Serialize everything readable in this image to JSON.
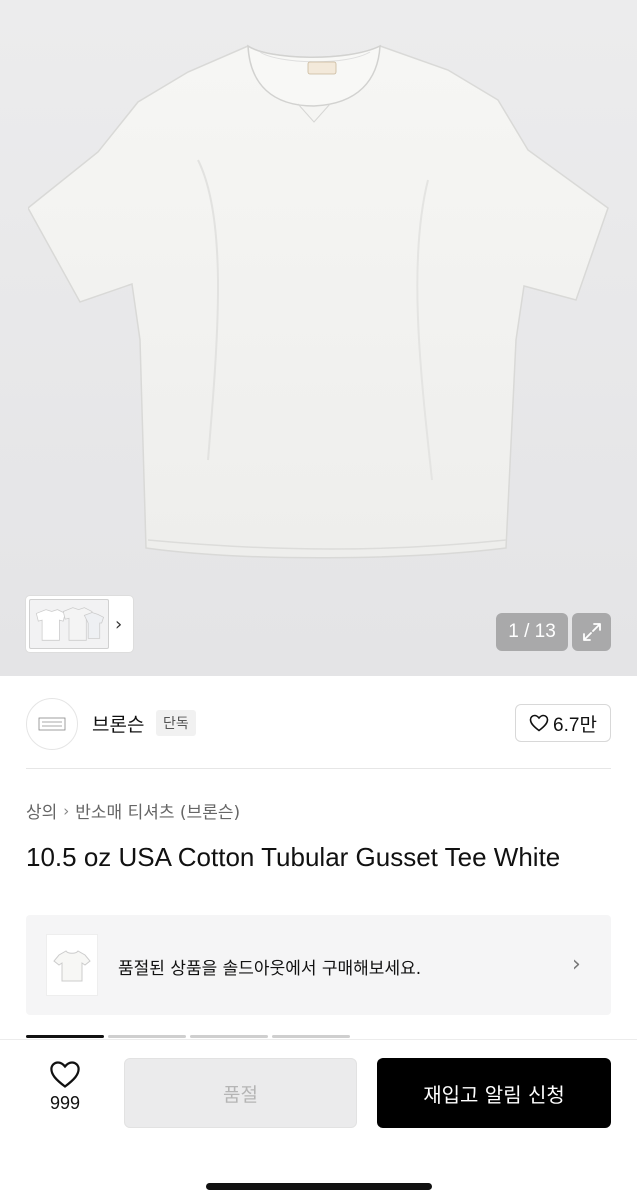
{
  "gallery": {
    "counter": "1 / 13",
    "product_image": "white-tshirt-photo",
    "thumbnail_image": "tshirt-variants-thumbnail"
  },
  "brand": {
    "name": "브론슨",
    "badge": "단독",
    "logo": "bronson-logo",
    "like_count": "6.7만"
  },
  "breadcrumb": {
    "category": "상의",
    "subcategory": "반소매 티셔츠 (브론슨)"
  },
  "product": {
    "title": "10.5 oz USA Cotton Tubular Gusset Tee White"
  },
  "soldout_banner": {
    "text": "품절된 상품을 솔드아웃에서 구매해보세요."
  },
  "action_bar": {
    "wish_count": "999",
    "soldout_label": "품절",
    "restock_label": "재입고 알림 신청"
  },
  "colors": {
    "primary_button": "#000000",
    "disabled_button": "#ebebec",
    "hero_background": "#e8e8ea"
  }
}
